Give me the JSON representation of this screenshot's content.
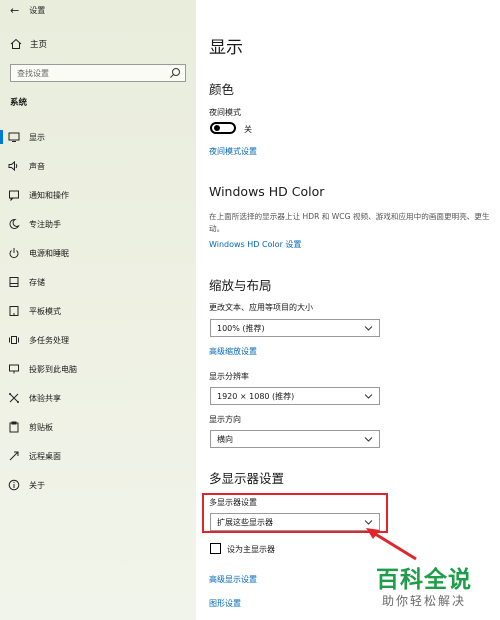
{
  "window": {
    "title": "设置"
  },
  "sidebar": {
    "home_label": "主页",
    "search_placeholder": "查找设置",
    "section_label": "系统",
    "items": [
      {
        "label": "显示",
        "icon": "display-icon",
        "active": true
      },
      {
        "label": "声音",
        "icon": "speaker-icon"
      },
      {
        "label": "通知和操作",
        "icon": "notification-icon"
      },
      {
        "label": "专注助手",
        "icon": "moon-icon"
      },
      {
        "label": "电源和睡眠",
        "icon": "power-icon"
      },
      {
        "label": "存储",
        "icon": "storage-icon"
      },
      {
        "label": "平板模式",
        "icon": "tablet-icon"
      },
      {
        "label": "多任务处理",
        "icon": "multitask-icon"
      },
      {
        "label": "投影到此电脑",
        "icon": "project-icon"
      },
      {
        "label": "体验共享",
        "icon": "share-icon"
      },
      {
        "label": "剪贴板",
        "icon": "clipboard-icon"
      },
      {
        "label": "远程桌面",
        "icon": "remote-icon"
      },
      {
        "label": "关于",
        "icon": "info-icon"
      }
    ]
  },
  "main": {
    "title": "显示",
    "color": {
      "heading": "颜色",
      "night_mode_label": "夜间模式",
      "night_mode_state": "关",
      "night_mode_link": "夜间模式设置"
    },
    "hdr": {
      "heading": "Windows HD Color",
      "description": "在上面所选择的显示器上让 HDR 和 WCG 视频、游戏和应用中的画面更明亮、更生动。",
      "link": "Windows HD Color 设置"
    },
    "scale": {
      "heading": "缩放与布局",
      "text_size_label": "更改文本、应用等项目的大小",
      "text_size_value": "100% (推荐)",
      "advanced_link": "高级缩放设置",
      "resolution_label": "显示分辨率",
      "resolution_value": "1920 × 1080 (推荐)",
      "orientation_label": "显示方向",
      "orientation_value": "横向"
    },
    "multi": {
      "heading": "多显示器设置",
      "label": "多显示器设置",
      "value": "扩展这些显示器",
      "primary_checkbox_label": "设为主显示器",
      "advanced_link": "高级显示设置",
      "graphics_link": "图形设置"
    }
  },
  "watermark": {
    "main": "百科全说",
    "sub": "助你轻松解决"
  },
  "colors": {
    "accent": "#0078d7",
    "link": "#0067b8",
    "highlight": "#e0262d",
    "watermark": "#1f9e4a"
  }
}
